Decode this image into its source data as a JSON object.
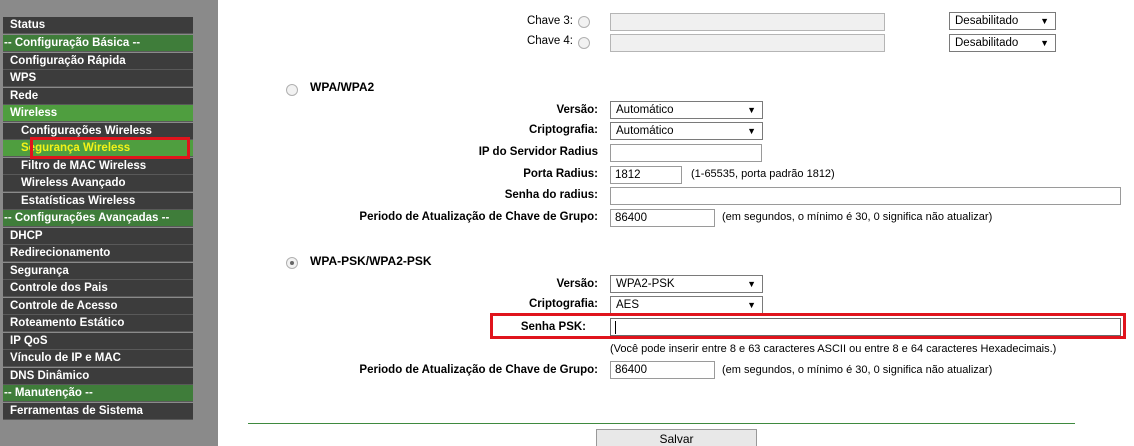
{
  "sidebar": {
    "items": [
      {
        "label": "Status"
      },
      {
        "label": "-- Configuração Básica --"
      },
      {
        "label": "Configuração Rápida"
      },
      {
        "label": "WPS"
      },
      {
        "label": "Rede"
      },
      {
        "label": "Wireless"
      },
      {
        "label": "Configurações Wireless"
      },
      {
        "label": "Segurança Wireless"
      },
      {
        "label": "Filtro de MAC Wireless"
      },
      {
        "label": "Wireless Avançado"
      },
      {
        "label": "Estatísticas Wireless"
      },
      {
        "label": "-- Configurações Avançadas --"
      },
      {
        "label": "DHCP"
      },
      {
        "label": "Redirecionamento"
      },
      {
        "label": "Segurança"
      },
      {
        "label": "Controle dos Pais"
      },
      {
        "label": "Controle de Acesso"
      },
      {
        "label": "Roteamento Estático"
      },
      {
        "label": "IP QoS"
      },
      {
        "label": "Vínculo de IP e MAC"
      },
      {
        "label": "DNS Dinâmico"
      },
      {
        "label": "-- Manutenção --"
      },
      {
        "label": "Ferramentas de Sistema"
      }
    ],
    "selected_item": "Segurança Wireless"
  },
  "wep_keys": [
    {
      "label": "Chave 3:",
      "value": "",
      "status": "Desabilitado"
    },
    {
      "label": "Chave 4:",
      "value": "",
      "status": "Desabilitado"
    }
  ],
  "wpa": {
    "title": "WPA/WPA2",
    "selected": false,
    "version_label": "Versão:",
    "version_value": "Automático",
    "crypto_label": "Criptografia:",
    "crypto_value": "Automático",
    "radius_ip_label": "IP do Servidor Radius",
    "radius_ip_value": "",
    "radius_port_label": "Porta Radius:",
    "radius_port_value": "1812",
    "radius_port_hint": "(1-65535, porta padrão 1812)",
    "radius_password_label": "Senha do radius:",
    "radius_password_value": "",
    "group_key_label": "Periodo de Atualização de Chave de Grupo:",
    "group_key_value": "86400",
    "group_key_hint": "(em segundos, o mínimo é 30, 0 significa não atualizar)"
  },
  "wpa_psk": {
    "title": "WPA-PSK/WPA2-PSK",
    "selected": true,
    "version_label": "Versão:",
    "version_value": "WPA2-PSK",
    "crypto_label": "Criptografia:",
    "crypto_value": "AES",
    "psk_label": "Senha PSK:",
    "psk_value": "",
    "psk_hint": "(Você pode inserir entre 8 e 63 caracteres ASCII ou entre 8 e 64 caracteres Hexadecimais.)",
    "group_key_label": "Periodo de Atualização de Chave de Grupo:",
    "group_key_value": "86400",
    "group_key_hint": "(em segundos, o mínimo é 30, 0 significa não atualizar)"
  },
  "actions": {
    "save_label": "Salvar"
  },
  "colors": {
    "highlight": "#e0141c",
    "sidebar_section": "#3f7d3a",
    "sidebar_active": "#4f9e3f",
    "sidebar_selected_text": "#f3f318"
  }
}
